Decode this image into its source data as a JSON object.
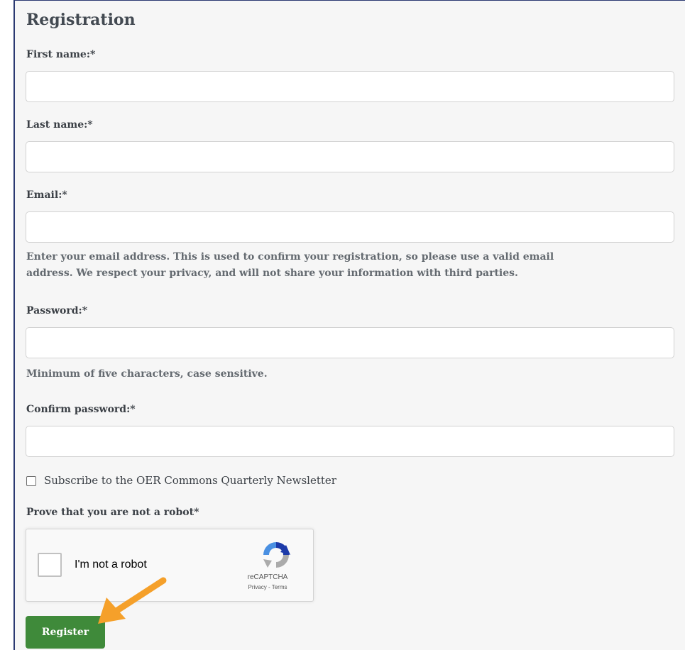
{
  "form": {
    "title": "Registration",
    "first_name": {
      "label": "First name:*",
      "value": ""
    },
    "last_name": {
      "label": "Last name:*",
      "value": ""
    },
    "email": {
      "label": "Email:*",
      "value": "",
      "help_line1": "Enter your email address. This is used to confirm your registration, so please use a valid email",
      "help_line2": "address. We respect your privacy, and will not share your information with third parties."
    },
    "password": {
      "label": "Password:*",
      "value": "",
      "help": "Minimum of five characters, case sensitive."
    },
    "confirm_password": {
      "label": "Confirm password:*",
      "value": ""
    },
    "newsletter": {
      "label": "Subscribe to the OER Commons Quarterly Newsletter",
      "checked": false
    },
    "robot_label": "Prove that you are not a robot*",
    "captcha": {
      "text": "I'm not a robot",
      "brand": "reCAPTCHA",
      "links": "Privacy - Terms",
      "logo_icon": "recaptcha-logo-icon"
    },
    "register_label": "Register"
  },
  "colors": {
    "panel_background": "#f6f6f6",
    "panel_border": "#2b3a72",
    "register_button": "#3f8a3a",
    "annotation_arrow": "#f5a02a",
    "recaptcha_blue": "#1c3aa9",
    "recaptcha_light_blue": "#4a90e2",
    "recaptcha_gray": "#ababab"
  }
}
